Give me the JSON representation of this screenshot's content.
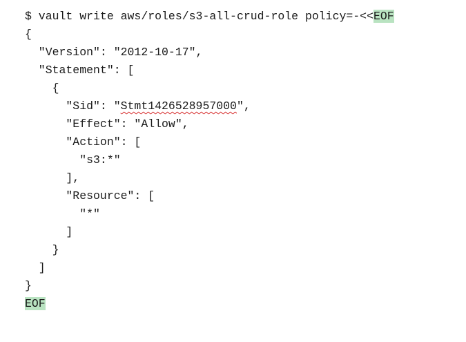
{
  "editor": {
    "command": {
      "prompt": "$ vault write aws/roles/s3-all-crud-role policy=-<<",
      "heredoc_marker": "EOF"
    },
    "lines": {
      "open_brace": "{",
      "version": "  \"Version\": \"2012-10-17\",",
      "statement_open": "  \"Statement\": [",
      "stmt_brace_open": "    {",
      "sid_prefix": "      \"Sid\": \"",
      "sid_value": "Stmt1426528957000",
      "sid_suffix": "\",",
      "effect": "      \"Effect\": \"Allow\",",
      "action_open": "      \"Action\": [",
      "action_value": "        \"s3:*\"",
      "action_close": "      ],",
      "resource_open": "      \"Resource\": [",
      "resource_value": "        \"*\"",
      "resource_close": "      ]",
      "stmt_brace_close": "    }",
      "statement_close": "  ]",
      "close_brace": "}"
    },
    "heredoc_end": "EOF",
    "colors": {
      "text": "#1a1a1a",
      "highlight": "#b9e3c1",
      "spellcheck": "#d62a2a"
    }
  }
}
